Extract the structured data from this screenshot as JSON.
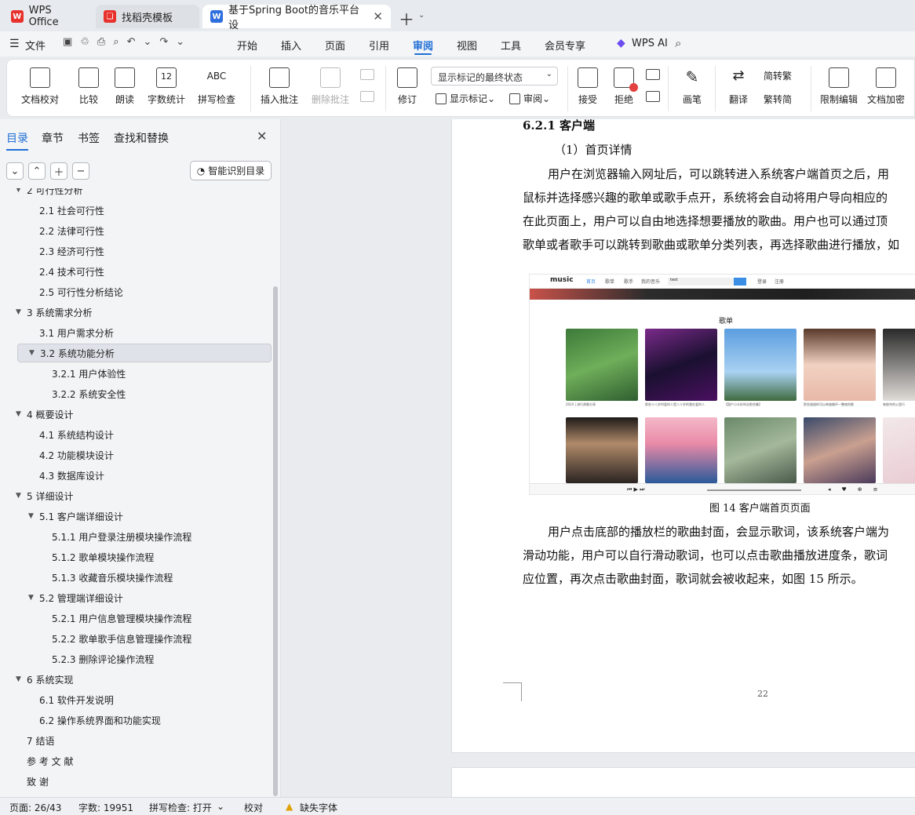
{
  "tabs": [
    {
      "label": "WPS Office"
    },
    {
      "label": "找稻壳模板"
    },
    {
      "label": "基于Spring Boot的音乐平台设"
    }
  ],
  "menu": {
    "file": "文件",
    "items": [
      "开始",
      "插入",
      "页面",
      "引用",
      "审阅",
      "视图",
      "工具",
      "会员专享"
    ],
    "active": "审阅",
    "wps_ai": "WPS AI"
  },
  "ribbon": {
    "doc_check": "文档校对",
    "compare": "比较",
    "read_aloud": "朗读",
    "word_count": "字数统计",
    "spell_check": "拼写检查",
    "insert_comment": "插入批注",
    "delete_comment": "删除批注",
    "revise": "修订",
    "markup_select": "显示标记的最终状态",
    "show_markup": "显示标记",
    "review": "审阅",
    "accept": "接受",
    "reject": "拒绝",
    "pen": "画笔",
    "translate": "翻译",
    "to_traditional": "简转繁",
    "to_simplified": "繁转简",
    "restrict_edit": "限制编辑",
    "encrypt": "文档加密",
    "word_count_icon_text": "12",
    "spell_icon_text": "ABC"
  },
  "nav": {
    "tabs": [
      "目录",
      "章节",
      "书签",
      "查找和替换"
    ],
    "active_tab": "目录",
    "smart_toc": "智能识别目录",
    "toc": [
      {
        "text": "2   可行性分析",
        "level": 1,
        "expanded": true
      },
      {
        "text": "2.1   社会可行性",
        "level": 2
      },
      {
        "text": "2.2   法律可行性",
        "level": 2
      },
      {
        "text": "2.3   经济可行性",
        "level": 2
      },
      {
        "text": "2.4   技术可行性",
        "level": 2
      },
      {
        "text": "2.5   可行性分析结论",
        "level": 2
      },
      {
        "text": "3   系统需求分析",
        "level": 1,
        "expanded": true
      },
      {
        "text": "3.1   用户需求分析",
        "level": 2
      },
      {
        "text": "3.2   系统功能分析",
        "level": 2,
        "expanded": true,
        "selected": true
      },
      {
        "text": "3.2.1 用户体验性",
        "level": 3
      },
      {
        "text": "3.2.2    系统安全性",
        "level": 3
      },
      {
        "text": "4   概要设计",
        "level": 1,
        "expanded": true
      },
      {
        "text": "4.1   系统结构设计",
        "level": 2
      },
      {
        "text": "4.2   功能模块设计",
        "level": 2
      },
      {
        "text": "4.3   数据库设计",
        "level": 2
      },
      {
        "text": "5   详细设计",
        "level": 1,
        "expanded": true
      },
      {
        "text": "5.1   客户端详细设计",
        "level": 2,
        "expanded": true
      },
      {
        "text": "5.1.1    用户登录注册模块操作流程",
        "level": 3
      },
      {
        "text": "5.1.2    歌单模块操作流程",
        "level": 3
      },
      {
        "text": "5.1.3    收藏音乐模块操作流程",
        "level": 3
      },
      {
        "text": "5.2   管理端详细设计",
        "level": 2,
        "expanded": true
      },
      {
        "text": "5.2.1    用户信息管理模块操作流程",
        "level": 3
      },
      {
        "text": "5.2.2    歌单歌手信息管理操作流程",
        "level": 3
      },
      {
        "text": "5.2.3    删除评论操作流程",
        "level": 3
      },
      {
        "text": "6   系统实现",
        "level": 1,
        "expanded": true
      },
      {
        "text": "6.1   软件开发说明",
        "level": 2
      },
      {
        "text": "6.2   操作系统界面和功能实现",
        "level": 2
      },
      {
        "text": "7   结语",
        "level": 1
      },
      {
        "text": "参   考   文   献",
        "level": 1
      },
      {
        "text": "致          谢",
        "level": 1
      }
    ]
  },
  "doc": {
    "heading": "6.2.1   客户端",
    "subheading": "（1）首页详情",
    "para1": [
      "用户在浏览器输入网址后，可以跳转进入系统客户端首页之后，用",
      "鼠标并选择感兴趣的歌单或歌手点开，系统将会自动将用户导向相应的",
      "在此页面上，用户可以自由地选择想要播放的歌曲。用户也可以通过顶",
      "歌单或者歌手可以跳转到歌曲或歌单分类列表，再选择歌曲进行播放，如"
    ],
    "figure_caption": "图 14  客户端首页页面",
    "para2": [
      "用户点击底部的播放栏的歌曲封面，会显示歌词，该系统客户端为",
      "滑动功能，用户可以自行滑动歌词，也可以点击歌曲播放进度条，歌词",
      "应位置，再次点击歌曲封面，歌词就会被收起来，如图 15 所示。"
    ],
    "page_number": "22",
    "screenshot": {
      "logo": "music",
      "nav": [
        "首页",
        "歌单",
        "歌手",
        "我的音乐"
      ],
      "search_value": "test",
      "login": "登录",
      "register": "注册",
      "section": "歌单",
      "captions": [
        "2024 | 流行热歌分享",
        "那些十八岁时爱的人是八十岁的我在爱的人",
        "【国产小众好听治愈合集】",
        "那些甜甜的可以单曲循环一整夜的歌",
        "林俊杰的公里行"
      ]
    }
  },
  "status": {
    "page": "页面: 26/43",
    "words": "字数: 19951",
    "spell": "拼写检查: 打开",
    "proof": "校对",
    "missing_font": "缺失字体"
  }
}
